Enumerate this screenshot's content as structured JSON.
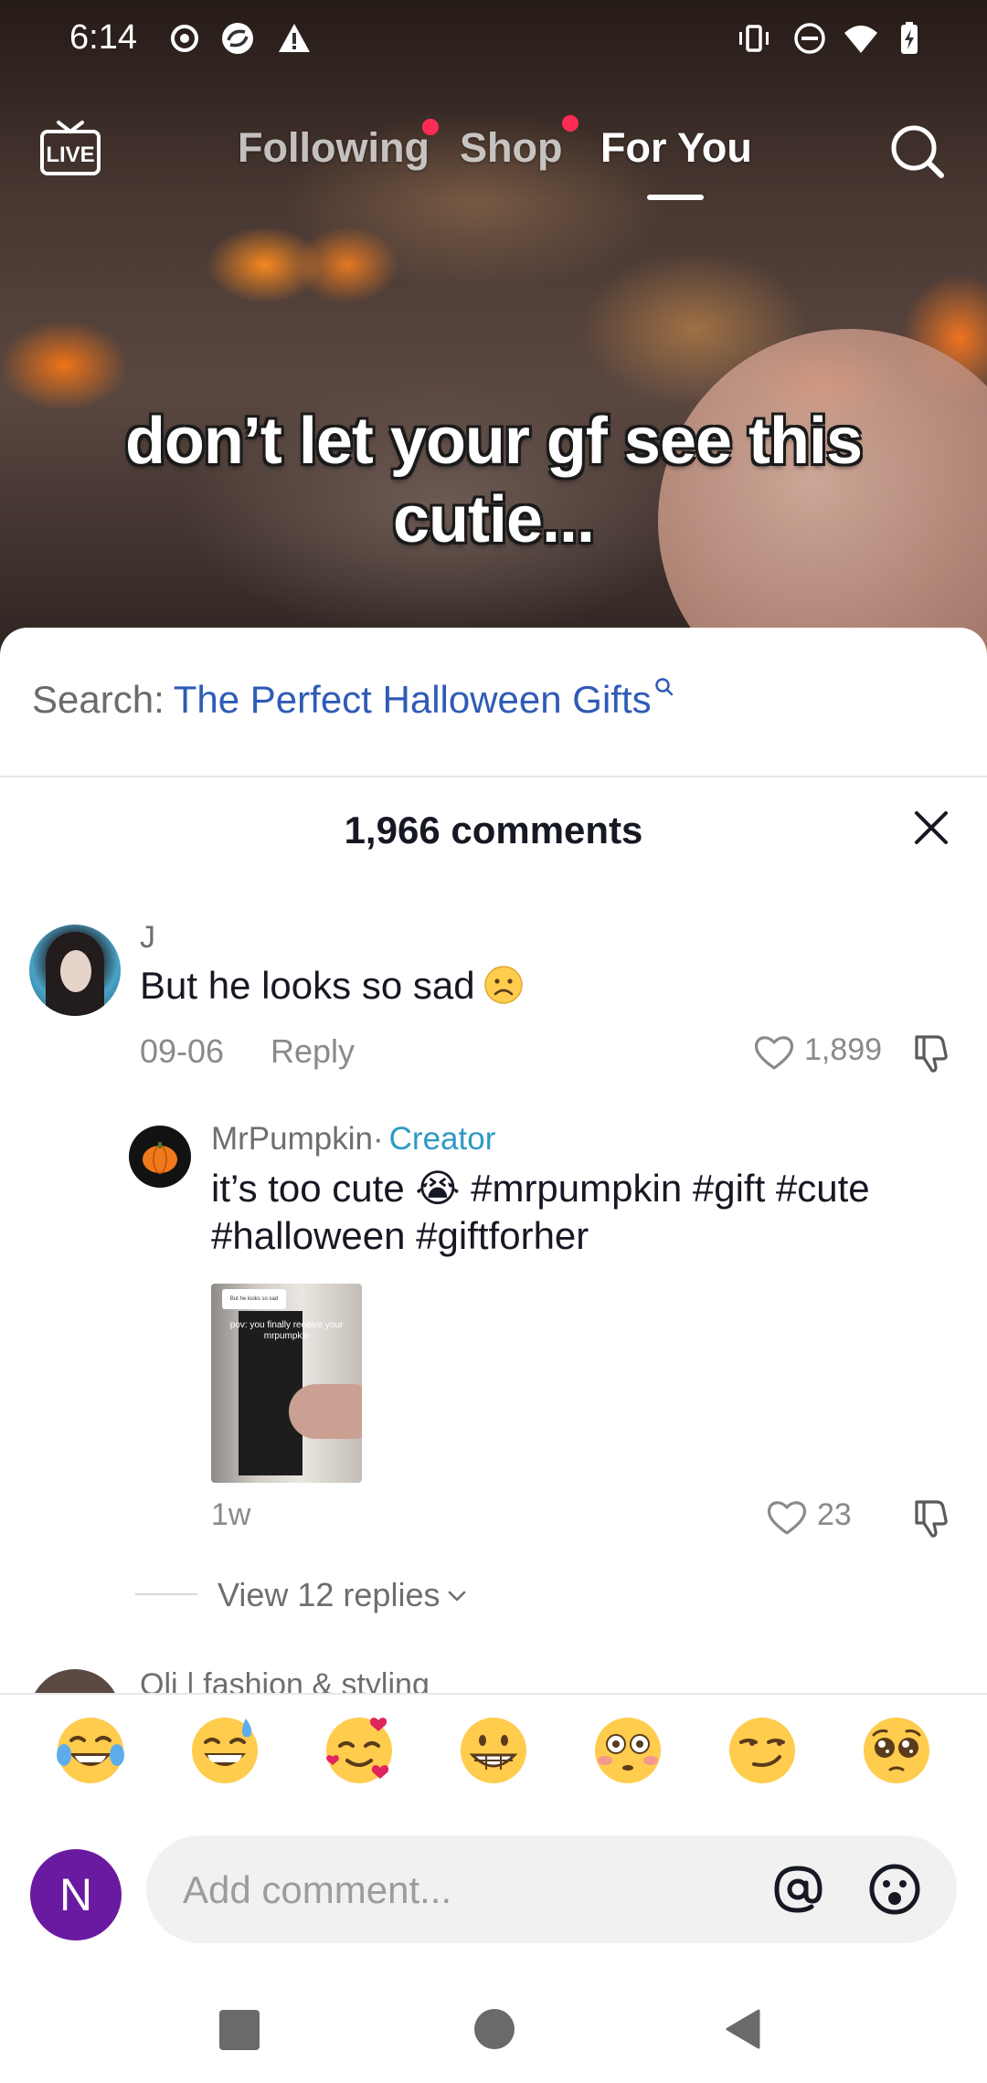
{
  "status_bar": {
    "time": "6:14"
  },
  "top_nav": {
    "tabs": [
      {
        "label": "Following",
        "has_dot": true
      },
      {
        "label": "Shop",
        "has_dot": true
      },
      {
        "label": "For You",
        "active": true
      }
    ],
    "live_icon": "live-tv-icon",
    "search_icon": "search-icon"
  },
  "video": {
    "caption_line1": "don’t let your gf see this",
    "caption_line2": "cutie..."
  },
  "search_suggestion": {
    "prefix": "Search:",
    "term": "The Perfect Halloween Gifts"
  },
  "comments": {
    "header": "1,966 comments",
    "items": [
      {
        "username": "J",
        "text": "But he looks so sad",
        "emoji": "sad-face-emoji",
        "date": "09-06",
        "reply_label": "Reply",
        "likes": "1,899",
        "replies": [
          {
            "username": "MrPumpkin",
            "separator": "·",
            "badge": "Creator",
            "text": "it’s too cute 😭 #mrpumpkin #gift #cute #halloween #giftforher",
            "time": "1w",
            "likes": "23",
            "thumbnail": {
              "sticker_text": "But he looks so sad",
              "caption": "pov: you finally receive your mrpumpkin"
            }
          }
        ],
        "view_replies_label": "View 12 replies"
      },
      {
        "username": "Oli | fashion & styling"
      }
    ]
  },
  "emoji_bar": [
    "tears-of-joy",
    "grinning-sweat",
    "smiling-hearts",
    "beaming-grin",
    "flushed",
    "smirk",
    "pleading"
  ],
  "composer": {
    "avatar_initial": "N",
    "placeholder": "Add comment..."
  },
  "colors": {
    "accent_red": "#fe2c55",
    "link_blue": "#2f5bb7",
    "creator_blue": "#2e9ac4",
    "avatar_purple": "#6a1aa0"
  }
}
